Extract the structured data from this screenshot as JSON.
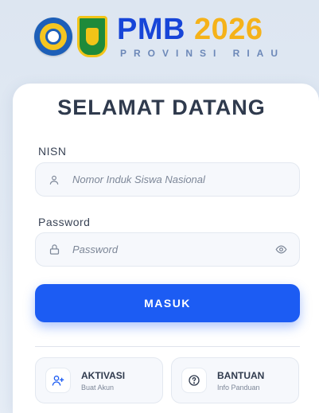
{
  "brand": {
    "title_pmb": "PMB",
    "title_year": "2026",
    "subtitle": "PROVINSI RIAU",
    "logo_left_icon": "tut-wuri-handayani-logo",
    "logo_right_icon": "riau-province-emblem",
    "colors": {
      "pmb": "#1745d8",
      "year": "#f5b21a"
    }
  },
  "card": {
    "title": "SELAMAT DATANG"
  },
  "form": {
    "nisn": {
      "label": "NISN",
      "placeholder": "Nomor Induk Siswa Nasional",
      "icon": "user-icon"
    },
    "password": {
      "label": "Password",
      "placeholder": "Password",
      "icon": "lock-icon",
      "toggle_icon": "eye-icon"
    },
    "submit_label": "MASUK",
    "accent": "#1c5cf3"
  },
  "links": [
    {
      "title": "AKTIVASI",
      "subtitle": "Buat Akun",
      "icon": "user-plus-icon"
    },
    {
      "title": "BANTUAN",
      "subtitle": "Info Panduan",
      "icon": "help-circle-icon"
    }
  ]
}
